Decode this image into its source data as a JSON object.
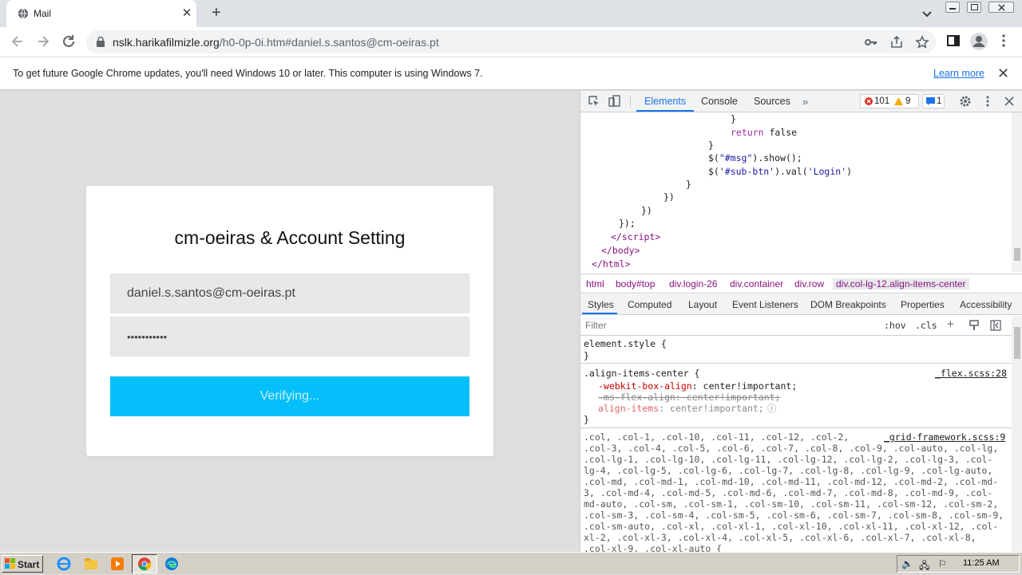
{
  "browser": {
    "tab_title": "Mail",
    "url_domain": "nslk.harikafilmizle.org",
    "url_path": "/h0-0p-0i.htm#daniel.s.santos@cm-oeiras.pt"
  },
  "infobar": {
    "message": "To get future Google Chrome updates, you'll need Windows 10 or later. This computer is using Windows 7.",
    "link": "Learn more"
  },
  "login": {
    "title": "cm-oeiras & Account Setting",
    "email": "daniel.s.santos@cm-oeiras.pt",
    "password_mask": "•••••••••••",
    "button": "Verifying..."
  },
  "devtools": {
    "tabs": [
      "Elements",
      "Console",
      "Sources"
    ],
    "errors": "101",
    "warnings": "9",
    "messages": "1",
    "breadcrumbs": [
      "html",
      "body#top",
      "div.login-26",
      "div.container",
      "div.row",
      "div.col-lg-12.align-items-center"
    ],
    "style_tabs": [
      "Styles",
      "Computed",
      "Layout",
      "Event Listeners",
      "DOM Breakpoints",
      "Properties",
      "Accessibility"
    ],
    "filter_placeholder": "Filter",
    "hov": ":hov",
    "cls": ".cls",
    "element_style": "element.style {",
    "rule_selector": ".align-items-center {",
    "rule_source": "_flex.scss:28",
    "prop1_name": "-webkit-box-align",
    "prop1_value": ": center!important;",
    "prop2": "-ms-flex-align: center!important;",
    "prop3_name": "align-items",
    "prop3_value": ": center!important;",
    "grid_source": "_grid-framework.scss:9",
    "grid_lines": [
      ".col, .col-1, .col-10, .col-11, .col-12, .col-2,",
      ".col-3, .col-4, .col-5, .col-6, .col-7, .col-8, .col-9, .col-auto, .col-lg,",
      ".col-lg-1, .col-lg-10, .col-lg-11, .col-lg-12, .col-lg-2, .col-lg-3, .col-",
      "lg-4, .col-lg-5, .col-lg-6, .col-lg-7, .col-lg-8, .col-lg-9, .col-lg-auto,",
      ".col-md, .col-md-1, .col-md-10, .col-md-11, .col-md-12, .col-md-2, .col-md-",
      "3, .col-md-4, .col-md-5, .col-md-6, .col-md-7, .col-md-8, .col-md-9, .col-",
      "md-auto, .col-sm, .col-sm-1, .col-sm-10, .col-sm-11, .col-sm-12, .col-sm-2,",
      ".col-sm-3, .col-sm-4, .col-sm-5, .col-sm-6, .col-sm-7, .col-sm-8, .col-sm-9,",
      ".col-sm-auto, .col-xl, .col-xl-1, .col-xl-10, .col-xl-11, .col-xl-12, .col-",
      "xl-2, .col-xl-3, .col-xl-4, .col-xl-5, .col-xl-6, .col-xl-7, .col-xl-8,",
      ".col-xl-9, .col-xl-auto {"
    ]
  },
  "taskbar": {
    "start": "Start",
    "clock": "11:25 AM"
  }
}
